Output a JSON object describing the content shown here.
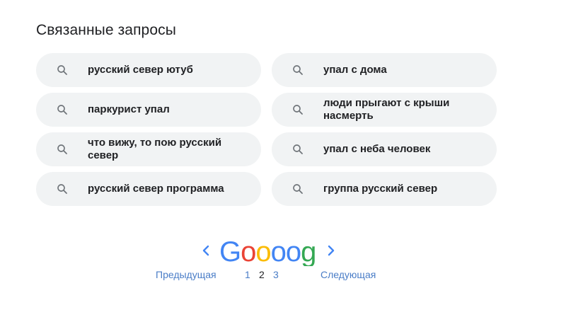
{
  "related": {
    "title": "Связанные запросы",
    "items": [
      {
        "label": "русский север ютуб"
      },
      {
        "label": "упал с дома"
      },
      {
        "label": "паркурист упал"
      },
      {
        "label": "люди прыгают с крыши насмерть"
      },
      {
        "label": "что вижу, то пою русский север"
      },
      {
        "label": "упал с неба человек"
      },
      {
        "label": "русский север программа"
      },
      {
        "label": "группа русский север"
      }
    ],
    "search_icon": "search-icon"
  },
  "pagination": {
    "logo_text": "Goooogle",
    "prev_label": "Предыдущая",
    "next_label": "Следующая",
    "pages": [
      "1",
      "2",
      "3"
    ],
    "current_page": "2",
    "arrow_prev_icon": "chevron-left-icon",
    "arrow_next_icon": "chevron-right-icon"
  },
  "colors": {
    "chip_bg": "#f1f3f4",
    "link": "#4a7dc7",
    "text": "#202124",
    "google_blue": "#4285f4",
    "google_red": "#ea4335",
    "google_yellow": "#fbbc05",
    "google_green": "#34a853"
  }
}
